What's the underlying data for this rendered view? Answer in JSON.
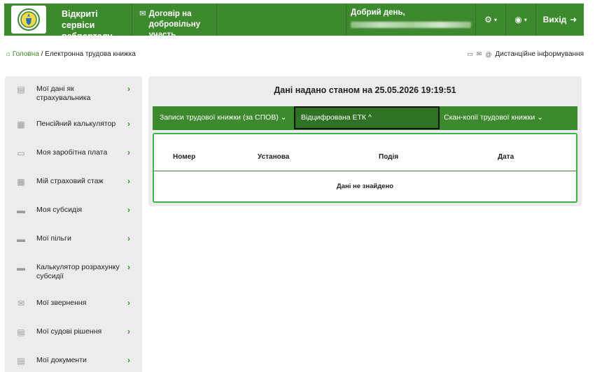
{
  "header": {
    "portal_title": "Відкриті сервіси вебпорталу",
    "contract_link": "Договір на добровільну участь",
    "greeting": "Добрий день,",
    "settings_icon": "gear-icon",
    "accessibility_icon": "eye-icon",
    "exit_label": "Вихід",
    "brand_color": "#3d8a2e"
  },
  "breadcrumb": {
    "home": "Головна",
    "separator": " / ",
    "current": "Електронна трудова книжка"
  },
  "remote_info": "Дистанційне інформування",
  "sidebar": {
    "items": [
      {
        "label": "Мої дані як страхувальника",
        "icon": "document-icon"
      },
      {
        "label": "Пенсійний калькулятор",
        "icon": "calculator-icon"
      },
      {
        "label": "Моя заробітна плата",
        "icon": "wallet-icon"
      },
      {
        "label": "Мій страховий стаж",
        "icon": "calendar-icon"
      },
      {
        "label": "Моя субсидія",
        "icon": "folder-icon"
      },
      {
        "label": "Мої пільги",
        "icon": "folder-icon"
      },
      {
        "label": "Калькулятор розрахунку субсидії",
        "icon": "folder-icon"
      },
      {
        "label": "Мої звернення",
        "icon": "mail-icon"
      },
      {
        "label": "Мої судові рішення",
        "icon": "document-icon"
      },
      {
        "label": "Мої документи",
        "icon": "document-icon"
      }
    ]
  },
  "main": {
    "title": "Дані надано станом на 25.05.2026 19:19:51",
    "tabs": [
      {
        "label": "Записи трудової книжки (за СПОВ) ⌄"
      },
      {
        "label": "Відцифрована ЕТК ^"
      },
      {
        "label": "Скан-копії трудової книжки ⌄"
      }
    ],
    "table": {
      "columns": [
        "Номер",
        "Установа",
        "Подія",
        "Дата"
      ],
      "empty_message": "Дані не знайдено"
    }
  }
}
